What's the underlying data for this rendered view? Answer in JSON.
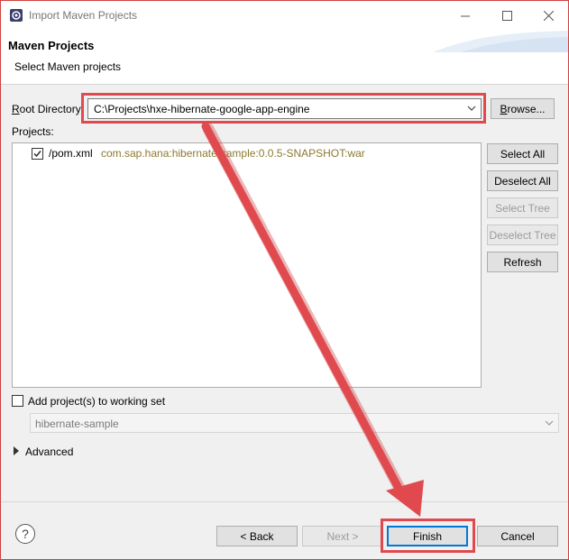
{
  "window": {
    "title": "Import Maven Projects"
  },
  "header": {
    "title": "Maven Projects",
    "subtitle": "Select Maven projects"
  },
  "root": {
    "label_mnemonic": "R",
    "label_rest": "oot Directory:",
    "value": "C:\\Projects\\hxe-hibernate-google-app-engine",
    "browse_mnemonic": "B",
    "browse_rest": "rowse..."
  },
  "projects": {
    "label": "Projects:",
    "items": [
      {
        "name": "/pom.xml",
        "gav": "com.sap.hana:hibernate-sample:0.0.5-SNAPSHOT:war",
        "checked": true
      }
    ]
  },
  "side_buttons": {
    "select_all": "Select All",
    "deselect_all": "Deselect All",
    "select_tree": "Select Tree",
    "deselect_tree": "Deselect Tree",
    "refresh": "Refresh"
  },
  "working_set": {
    "label": "Add project(s) to working set",
    "value": "hibernate-sample",
    "checked": false
  },
  "advanced": {
    "label": "Advanced"
  },
  "footer": {
    "back": "< Back",
    "next": "Next >",
    "finish": "Finish",
    "cancel": "Cancel",
    "help": "?"
  },
  "colors": {
    "annotation": "#e04a4e",
    "accent": "#0078d7"
  },
  "icons": [
    "app-icon",
    "minimize-icon",
    "maximize-icon",
    "close-icon",
    "chevron-down-icon",
    "checkbox-icon",
    "expand-arrow-icon",
    "help-icon",
    "annotation-arrow"
  ]
}
